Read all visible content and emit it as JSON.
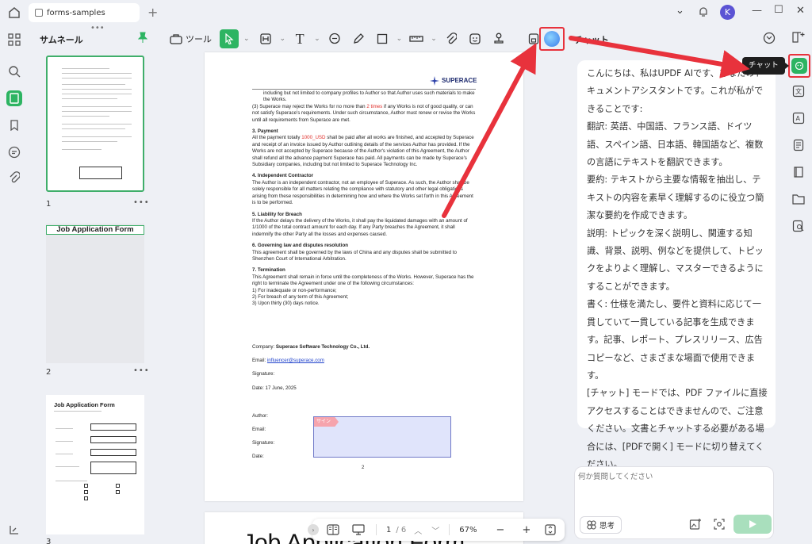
{
  "titlebar": {
    "tab_label": "forms-samples",
    "avatar_letter": "K"
  },
  "thumbnails": {
    "title": "サムネール",
    "pages": [
      {
        "number": "1"
      },
      {
        "number": "2",
        "heading": "Job Application Form"
      },
      {
        "number": "3",
        "heading": "Job Application Form"
      }
    ]
  },
  "toolbar": {
    "tool_label": "ツール"
  },
  "document": {
    "logo_text": "SUPERACE",
    "para_intro": "including but not limited to company profiles to Author so that Author uses such materials to make the Works.",
    "item3_prefix": "(3)   Superace may reject the Works for no more than ",
    "item3_red": "2 times",
    "item3_suffix": " if any Works is not of good quality, or can not satisfy Superace's requirements. Under such circumstance, Author must renew or revise the Works until all requirements from Superace are met.",
    "sec3_title": "3.        Payment",
    "sec3_prefix": "All the payment totally ",
    "sec3_red": "1000_USD",
    "sec3_suffix": " shall be paid after all works are finished, and accepted by Superace and receipt of an invoice issued by Author outlining details of the services Author has provided. If the Works are not accepted by Superace because of the Author's violation of this Agreement, the Author shall refund all the advance payment Superace has paid. All payments can be made by Superace's Subsidiary companies, including but not limited to Superace Technology Inc.",
    "sec4_title": "4.        Independent Contractor",
    "sec4_body": "The Author is an independent contractor, not an employee of Superace. As such, the Author shall be solely responsible for all matters relating the compliance with statutory and other legal obligations arising from these responsibilities in determining how and where the Works set forth in this Agreement is to be performed.",
    "sec5_title": "5.        Liability for Breach",
    "sec5_body": "If the Author delays the delivery of the Works, it shall pay the liquidated damages with an amount of 1/1000 of the total contract amount for each day. If any Party breaches the Agreement, it shall indemnify the other Party all the losses and expenses caused.",
    "sec6_title": "6.        Governing law and disputes resolution",
    "sec6_body": "This agreement shall be governed by the laws of China and any disputes shall be submitted to Shenzhen Court of International Arbitration.",
    "sec7_title": "7.        Termination",
    "sec7_body": "This Agreement shall remain in force until the completeness of the Works. However, Superace has the right to terminate the Agreement under one of the following circumstances:",
    "sec7_items": [
      "1) For inadequate or non-performance;",
      "2) For breach of any term of this Agreement;",
      "3)  Upon thirty (30) days notice."
    ],
    "company_label": "Company: ",
    "company_name": "Superace Software Technology Co., Ltd.",
    "email_label": "Email: ",
    "email_value": "influencer@superace.com",
    "signature_label": "Signature:",
    "date_line": "Date: 17 June, 2025",
    "author_label": "Author:",
    "email2_label": "Email:",
    "signature2_label": "Signature:",
    "date2_label": "Date:",
    "sign_tag": "サイン",
    "page_number": "2",
    "page2_heading": "Job Application Form"
  },
  "bottombar": {
    "page_current": "1",
    "page_total": "/ 6",
    "zoom": "67%"
  },
  "chat": {
    "title": "チャット",
    "tooltip": "チャット",
    "message": [
      "こんにちは、私はUPDF AIです、あなたのドキュメントアシスタントです。これが私ができることです:",
      "翻訳: 英語、中国語、フランス語、ドイツ語、スペイン語、日本語、韓国語など、複数の言語にテキストを翻訳できます。",
      "要約: テキストから主要な情報を抽出し、テキストの内容を素早く理解するのに役立つ簡潔な要約を作成できます。",
      "説明: トピックを深く説明し、関連する知識、背景、説明、例などを提供して、トピックをよりよく理解し、マスターできるようにすることができます。",
      "書く: 仕様を満たし、要件と資料に応じて一貫していて一貫している記事を生成できます。記事、レポート、プレスリリース、広告コピーなど、さまざまな場面で使用できます。",
      "[チャット] モードでは、PDF ファイルに直接アクセスすることはできませんので、ご注意ください。文書とチャットする必要がある場合には、[PDFで開く] モードに切り替えてください。"
    ],
    "input_placeholder": "何か質問してください",
    "think_label": "思考"
  },
  "colors": {
    "accent_green": "#2db462",
    "annotation_red": "#e8323c"
  }
}
